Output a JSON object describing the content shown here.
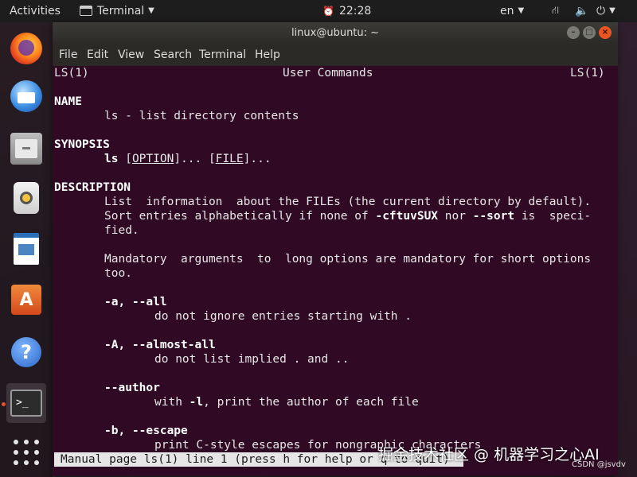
{
  "topbar": {
    "activities": "Activities",
    "app_name": "Terminal",
    "clock": "22:28",
    "language": "en",
    "icons": {
      "alarm": "alarm-icon",
      "network": "network-icon",
      "volume": "volume-icon",
      "power": "power-icon"
    }
  },
  "dock": {
    "items": [
      {
        "name": "Firefox",
        "icon": "firefox-icon"
      },
      {
        "name": "Thunderbird",
        "icon": "thunderbird-icon"
      },
      {
        "name": "Files",
        "icon": "files-icon"
      },
      {
        "name": "Rhythmbox",
        "icon": "rhythmbox-icon"
      },
      {
        "name": "LibreOffice Writer",
        "icon": "writer-icon"
      },
      {
        "name": "Ubuntu Software",
        "icon": "software-icon",
        "glyph": "A"
      },
      {
        "name": "Help",
        "icon": "help-icon",
        "glyph": "?"
      },
      {
        "name": "Terminal",
        "icon": "terminal-icon",
        "glyph": ">_",
        "active": true
      },
      {
        "name": "Show Applications",
        "icon": "app-grid-icon"
      }
    ]
  },
  "window": {
    "title": "linux@ubuntu: ~",
    "accent": "#e95420",
    "background": "#300a24",
    "menu": [
      "File",
      "Edit",
      "View",
      "Search",
      "Terminal",
      "Help"
    ]
  },
  "man": {
    "header_left": "LS(1)",
    "header_center": "User Commands",
    "header_right": "LS(1)",
    "name_heading": "NAME",
    "name_line": "ls - list directory contents",
    "synopsis_heading": "SYNOPSIS",
    "synopsis_cmd": "ls",
    "synopsis_option": "OPTION",
    "synopsis_mid": "]... [",
    "synopsis_file": "FILE",
    "synopsis_end": "]...",
    "synopsis_open": " [",
    "description_heading": "DESCRIPTION",
    "desc1": "List  information  about the FILEs (the current directory by default).",
    "desc2a": "Sort entries alphabetically if none of ",
    "desc2b": "-cftuvSUX",
    "desc2c": " nor ",
    "desc2d": "--sort",
    "desc2e": " is  speci-",
    "desc3": "fied.",
    "desc4": "Mandatory  arguments  to  long options are mandatory for short options",
    "desc5": "too.",
    "opt_a": "-a, --all",
    "opt_a_desc": "do not ignore entries starting with .",
    "opt_A": "-A, --almost-all",
    "opt_A_desc": "do not list implied . and ..",
    "opt_author": "--author",
    "opt_author_desc_a": "with ",
    "opt_author_desc_b": "-l",
    "opt_author_desc_c": ", print the author of each file",
    "opt_b": "-b, --escape",
    "opt_b_desc": "print C-style escapes for nongraphic characters",
    "status": "Manual page ls(1) line 1 (press h for help or q to quit)"
  },
  "watermark": {
    "text": "掘金技术社区 @ 机器学习之心AI",
    "sub": "CSDN @jsvdv"
  }
}
